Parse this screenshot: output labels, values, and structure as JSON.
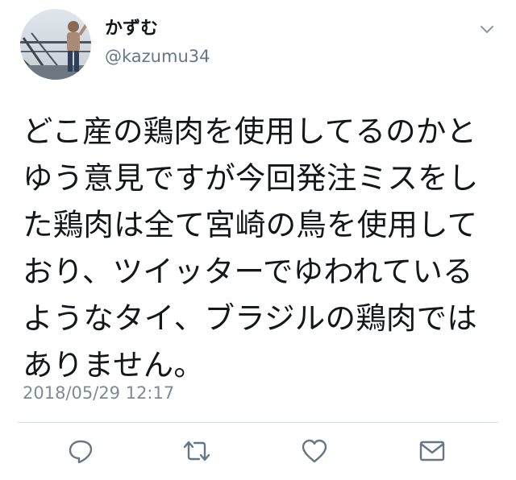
{
  "user": {
    "display_name": "かずむ",
    "handle": "@kazumu34",
    "avatar_icon": "profile-photo"
  },
  "tweet": {
    "lines": [
      "どこ産の鶏肉を使用してるのかと",
      "ゆう意見ですが今回発注ミスをし",
      "た鶏肉は全て宮崎の鳥を使用して",
      "おり、ツイッターでゆわれている",
      "ようなタイ、ブラジルの鶏肉では",
      "ありません。"
    ],
    "timestamp": "2018/05/29 12:17"
  },
  "actions": {
    "reply_icon": "reply-icon",
    "retweet_icon": "retweet-icon",
    "like_icon": "heart-icon",
    "dm_icon": "envelope-icon"
  },
  "colors": {
    "text": "#14171a",
    "secondary": "#657786",
    "icon": "#657786",
    "divider": "#d6dce1"
  }
}
